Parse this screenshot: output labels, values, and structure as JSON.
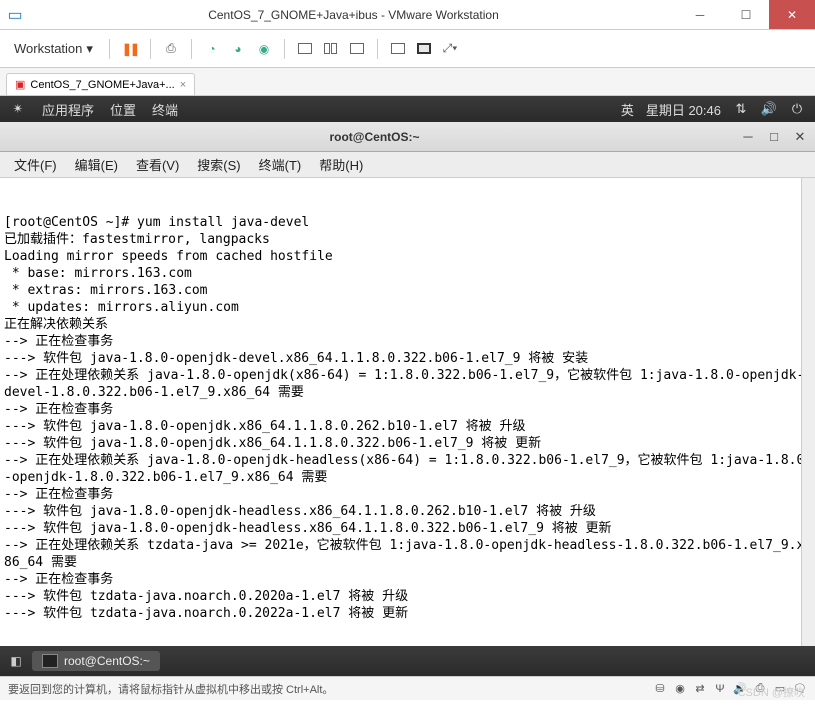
{
  "vmware": {
    "title": "CentOS_7_GNOME+Java+ibus - VMware Workstation",
    "workstation_menu": "Workstation",
    "tab_label": "CentOS_7_GNOME+Java+...",
    "status_text": "要返回到您的计算机，请将鼠标指针从虚拟机中移出或按 Ctrl+Alt。"
  },
  "gnome": {
    "apps": "应用程序",
    "places": "位置",
    "terminal": "终端",
    "ime": "英",
    "datetime": "星期日 20:46",
    "task_title": "root@CentOS:~"
  },
  "terminal": {
    "title": "root@CentOS:~",
    "menu": {
      "file": "文件(F)",
      "edit": "编辑(E)",
      "view": "查看(V)",
      "search": "搜索(S)",
      "terminal": "终端(T)",
      "help": "帮助(H)"
    },
    "lines": [
      "[root@CentOS ~]# yum install java-devel",
      "已加载插件：fastestmirror, langpacks",
      "Loading mirror speeds from cached hostfile",
      " * base: mirrors.163.com",
      " * extras: mirrors.163.com",
      " * updates: mirrors.aliyun.com",
      "正在解决依赖关系",
      "--> 正在检查事务",
      "---> 软件包 java-1.8.0-openjdk-devel.x86_64.1.1.8.0.322.b06-1.el7_9 将被 安装",
      "--> 正在处理依赖关系 java-1.8.0-openjdk(x86-64) = 1:1.8.0.322.b06-1.el7_9，它被软件包 1:java-1.8.0-openjdk-devel-1.8.0.322.b06-1.el7_9.x86_64 需要",
      "--> 正在检查事务",
      "---> 软件包 java-1.8.0-openjdk.x86_64.1.1.8.0.262.b10-1.el7 将被 升级",
      "---> 软件包 java-1.8.0-openjdk.x86_64.1.1.8.0.322.b06-1.el7_9 将被 更新",
      "--> 正在处理依赖关系 java-1.8.0-openjdk-headless(x86-64) = 1:1.8.0.322.b06-1.el7_9，它被软件包 1:java-1.8.0-openjdk-1.8.0.322.b06-1.el7_9.x86_64 需要",
      "--> 正在检查事务",
      "---> 软件包 java-1.8.0-openjdk-headless.x86_64.1.1.8.0.262.b10-1.el7 将被 升级",
      "---> 软件包 java-1.8.0-openjdk-headless.x86_64.1.1.8.0.322.b06-1.el7_9 将被 更新",
      "--> 正在处理依赖关系 tzdata-java >= 2021e，它被软件包 1:java-1.8.0-openjdk-headless-1.8.0.322.b06-1.el7_9.x86_64 需要",
      "--> 正在检查事务",
      "---> 软件包 tzdata-java.noarch.0.2020a-1.el7 将被 升级",
      "---> 软件包 tzdata-java.noarch.0.2022a-1.el7 将被 更新"
    ]
  },
  "watermark": "CSDN @撩吹"
}
